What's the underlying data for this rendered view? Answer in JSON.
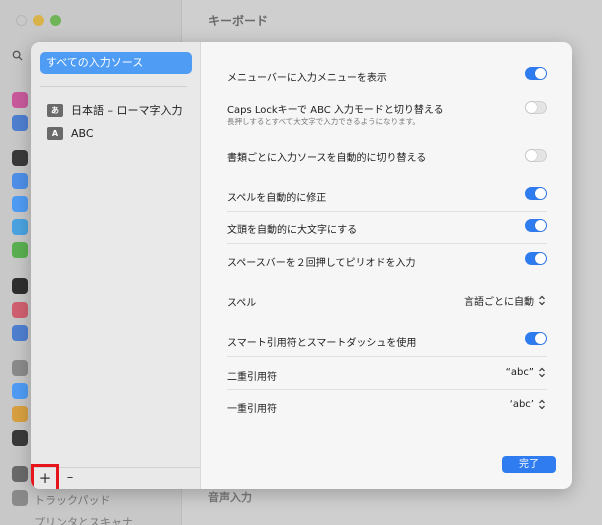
{
  "background": {
    "window_title": "キーボード",
    "bottom_items": [
      "トラックパッド",
      "プリンタとスキャナ"
    ],
    "right_section_label": "音声入力"
  },
  "sidebar": {
    "all_sources_label": "すべての入力ソース",
    "sources": [
      {
        "badge": "あ",
        "label": "日本語 – ローマ字入力"
      },
      {
        "badge": "A",
        "label": "ABC"
      }
    ],
    "add_label": "+",
    "remove_label": "–"
  },
  "settings": {
    "show_menu": {
      "label": "メニューバーに入力メニューを表示",
      "on": true
    },
    "capslock": {
      "label": "Caps Lockキーで ABC 入力モードと切り替える",
      "sub": "長押しするとすべて大文字で入力できるようになります。",
      "on": false
    },
    "auto_switch": {
      "label": "書類ごとに入力ソースを自動的に切り替える",
      "on": false
    },
    "spell_correct": {
      "label": "スペルを自動的に修正",
      "on": true
    },
    "capitalize": {
      "label": "文頭を自動的に大文字にする",
      "on": true
    },
    "period": {
      "label": "スペースバーを２回押してピリオドを入力",
      "on": true
    },
    "spelling": {
      "label": "スペル",
      "value": "言語ごとに自動"
    },
    "smart_quotes": {
      "label": "スマート引用符とスマートダッシュを使用",
      "on": true
    },
    "double_quotes": {
      "label": "二重引用符",
      "value": "“abc”"
    },
    "single_quotes": {
      "label": "一重引用符",
      "value": "‘abc’"
    }
  },
  "done_label": "完了",
  "colors": {
    "accent": "#2f7cf0",
    "selection": "#4f9cf4",
    "highlight": "#e8141c"
  }
}
